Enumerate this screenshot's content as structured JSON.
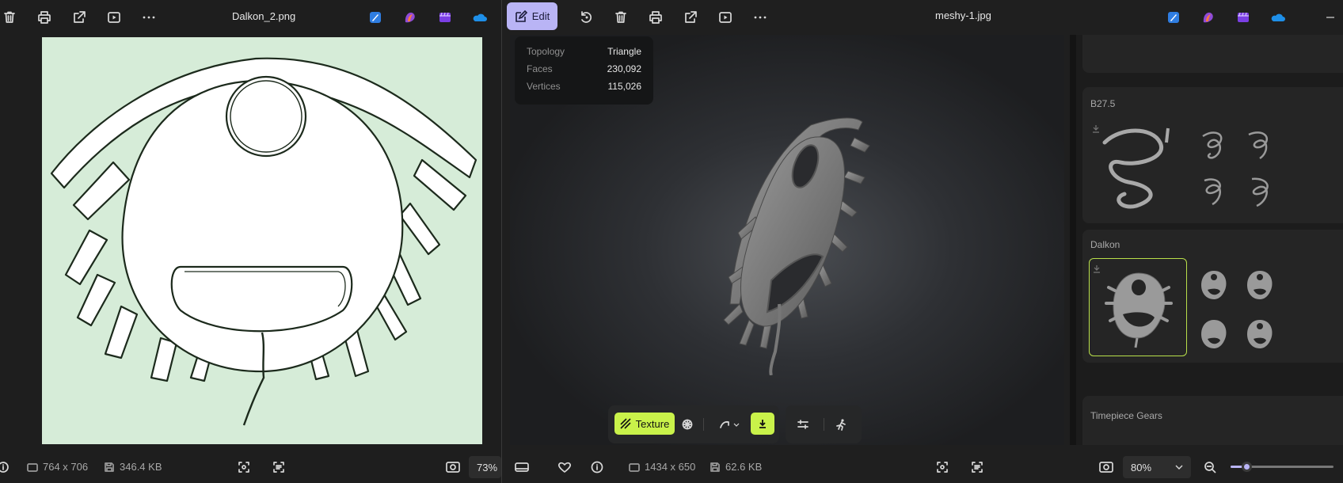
{
  "left_window": {
    "title": "Dalkon_2.png",
    "toolbar_icons": [
      "delete-icon",
      "print-icon",
      "share-icon",
      "slideshow-icon",
      "more-icon"
    ],
    "app_icons": [
      "designer-icon",
      "copilot-icon",
      "clipchamp-icon",
      "onedrive-icon"
    ],
    "status": {
      "dimensions": "764 x 706",
      "file_size": "346.4 KB",
      "zoom": "73%"
    }
  },
  "right_window": {
    "title": "meshy-1.jpg",
    "edit_label": "Edit",
    "toolbar_icons": [
      "edit-icon",
      "rotate-icon",
      "delete-icon",
      "print-icon",
      "share-icon",
      "slideshow-icon",
      "more-icon"
    ],
    "app_icons": [
      "designer-icon",
      "copilot-icon",
      "clipchamp-icon",
      "onedrive-icon"
    ],
    "window_controls": [
      "minimize-icon"
    ],
    "model_info": [
      {
        "key": "Topology",
        "value": "Triangle"
      },
      {
        "key": "Faces",
        "value": "230,092"
      },
      {
        "key": "Vertices",
        "value": "115,026"
      }
    ],
    "viewer_toolbar": {
      "texture_label": "Texture"
    },
    "panel": {
      "tools": [
        "grid-icon",
        "cube-icon",
        "texture-icon",
        "pose-icon",
        "filter-icon"
      ],
      "cards": [
        {
          "title": "B27.5"
        },
        {
          "title": "Dalkon"
        },
        {
          "title": "Timepiece Gears"
        }
      ]
    },
    "status": {
      "dimensions": "1434 x 650",
      "file_size": "62.6 KB",
      "zoom": "80%",
      "zoom_slider_fraction": 0.15
    }
  }
}
